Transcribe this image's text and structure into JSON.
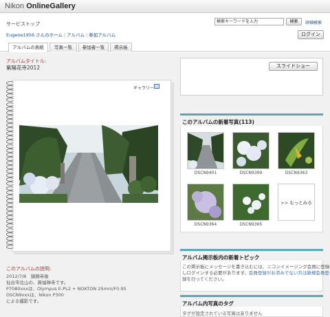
{
  "header": {
    "logo_prefix": "Nikon ",
    "logo_main": "OnlineGallery"
  },
  "service_top": "サービストップ",
  "search": {
    "placeholder": "検索キーワードを入力",
    "button": "検索",
    "advanced": "詳細検索"
  },
  "breadcrumb": {
    "home": "Eugene1956 さんのホーム",
    "album": "アルバム",
    "joined": "参加アルバム"
  },
  "login_label": "ログイン",
  "tabs": [
    {
      "label": "アルバムの表紙",
      "active": true
    },
    {
      "label": "写真一覧",
      "active": false
    },
    {
      "label": "参加者一覧",
      "active": false
    },
    {
      "label": "掲示板",
      "active": false
    }
  ],
  "album": {
    "title_label": "アルバムタイトル:",
    "title": "紫陽花寺2012",
    "gallery_label": "ギャラリー"
  },
  "description": {
    "title": "このアルバムの説明:",
    "lines": [
      "2012/7/8　鎮錦寺後",
      "仙台市北山の、資福禅寺です。",
      "P7080xxxは、Olympus E-PL2 + NOKTON 25mm/F0.95",
      "DSCN9xxxは、Nikon P300",
      "による撮影です。"
    ]
  },
  "slideshow_label": "スライドショー",
  "new_photos": {
    "title": "このアルバムの新着写真(113)",
    "items": [
      {
        "name": "DSCN9401"
      },
      {
        "name": "DSCN9399"
      },
      {
        "name": "DSCN9363"
      },
      {
        "name": "DSCN9364"
      },
      {
        "name": "DSCN9365"
      }
    ],
    "more_label": ">> もっとみる"
  },
  "bbs": {
    "title": "アルバム掲示板内の新着トピック",
    "line1": "この掲示板にメッセージを書き込むには、ニコンイメージング会員に登録",
    "line2": "しログインする必要があります。",
    "line2_note": "会員登録がお済みでない方は新規会員登",
    "line3": "録を行ってください。"
  },
  "tags": {
    "title": "アルバム内写真のタグ",
    "empty": "タグが設定されている写真はありません"
  },
  "colors": {
    "accent_teal": "#5aa6b5",
    "label_red": "#9a3a3a",
    "link_blue": "#1f4f8f"
  }
}
